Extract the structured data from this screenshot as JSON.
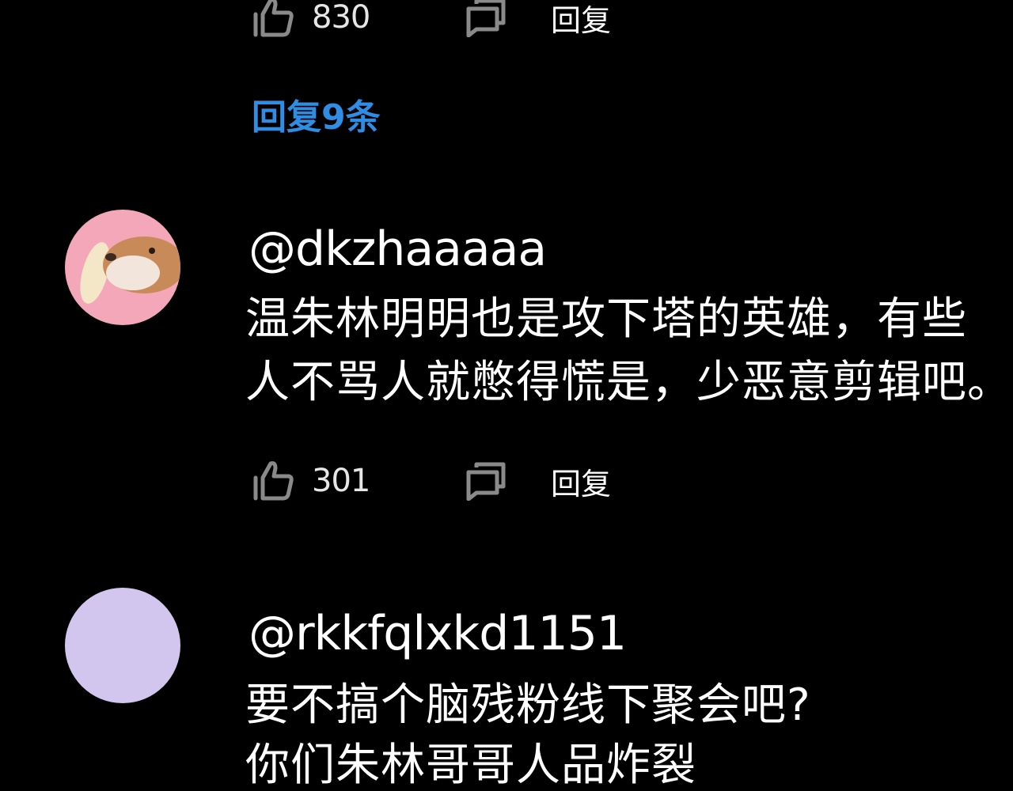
{
  "colors": {
    "background": "#000000",
    "link": "#2f8de4",
    "icon": "#8a8a8a",
    "avatar2": "#d2c6ee"
  },
  "comment_top": {
    "like_count": "830",
    "reply_label": "回复",
    "view_replies": "回复9条"
  },
  "comment_1": {
    "username": "@dkzhaaaaa",
    "text_lines": [
      "温朱林明明也是攻下塔的英雄，有些",
      "人不骂人就憋得慌是，少恶意剪辑吧。"
    ],
    "like_count": "301",
    "reply_label": "回复"
  },
  "comment_2": {
    "username": "@rkkfqlxkd1151",
    "text_lines": [
      "要不搞个脑残粉线下聚会吧?",
      "你们朱林哥哥人品炸裂"
    ]
  },
  "icons": {
    "like": "thumbs-up-icon",
    "reply": "reply-bubble-icon"
  }
}
